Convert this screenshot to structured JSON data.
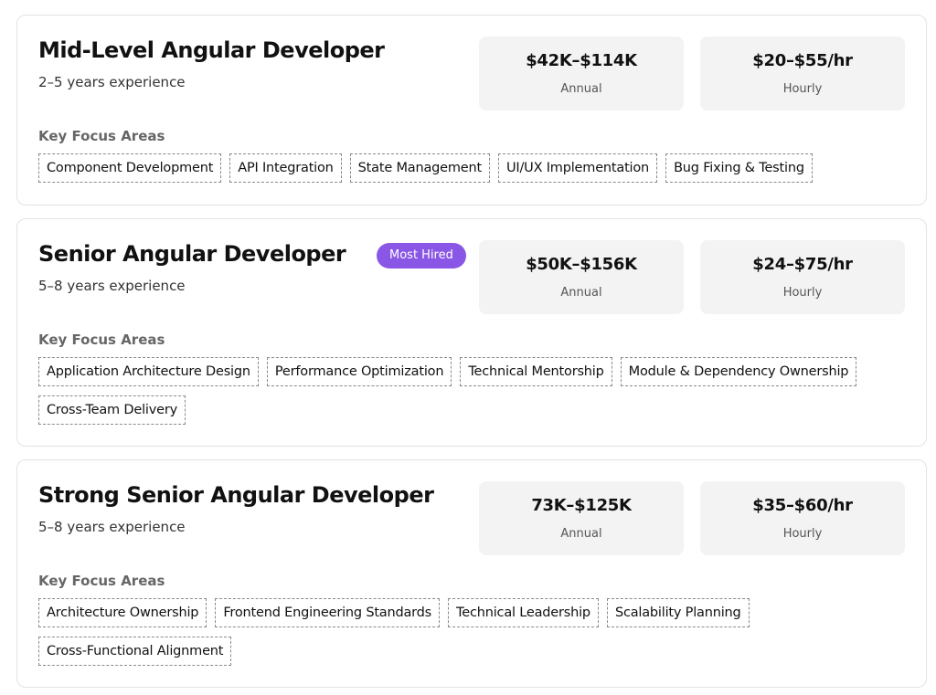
{
  "roles": [
    {
      "title": "Mid-Level Angular Developer",
      "experience": "2–5 years experience",
      "badge": "",
      "annual": {
        "value": "$42K–$114K",
        "label": "Annual"
      },
      "hourly": {
        "value": "$20–$55/hr",
        "label": "Hourly"
      },
      "focus_heading": "Key Focus Areas",
      "tags": [
        "Component Development",
        "API Integration",
        "State Management",
        "UI/UX Implementation",
        "Bug Fixing & Testing"
      ]
    },
    {
      "title": "Senior Angular Developer",
      "experience": "5–8 years experience",
      "badge": "Most Hired",
      "annual": {
        "value": "$50K–$156K",
        "label": "Annual"
      },
      "hourly": {
        "value": "$24–$75/hr",
        "label": "Hourly"
      },
      "focus_heading": "Key Focus Areas",
      "tags": [
        "Application Architecture Design",
        "Performance Optimization",
        "Technical Mentorship",
        "Module & Dependency Ownership",
        "Cross-Team Delivery"
      ]
    },
    {
      "title": "Strong Senior Angular Developer",
      "experience": "5–8 years experience",
      "badge": "",
      "annual": {
        "value": "73K–$125K",
        "label": "Annual"
      },
      "hourly": {
        "value": "$35–$60/hr",
        "label": "Hourly"
      },
      "focus_heading": "Key Focus Areas",
      "tags": [
        "Architecture Ownership",
        "Frontend Engineering Standards",
        "Technical Leadership",
        "Scalability Planning",
        "Cross-Functional Alignment"
      ]
    }
  ],
  "colors": {
    "badge": "#8a56e6",
    "salary_box": "#f3f3f3",
    "card_border": "#e3e3e3"
  }
}
